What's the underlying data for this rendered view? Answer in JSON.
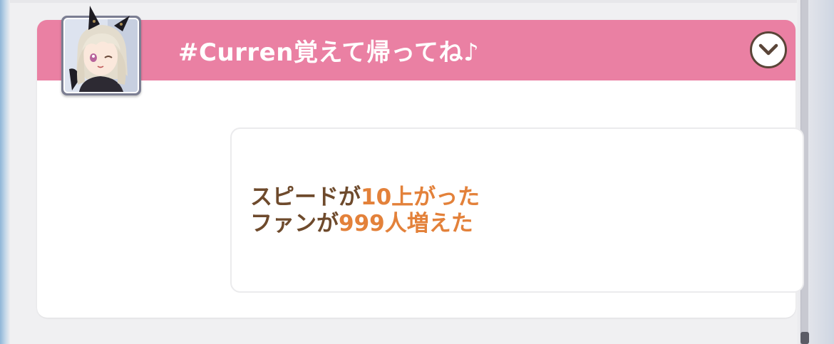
{
  "header": {
    "title": "#Curren覚えて帰ってね♪",
    "toggle_icon": "chevron-down-icon",
    "background_color": "#ea80a3"
  },
  "avatar": {
    "description_icon": "character-avatar"
  },
  "message": {
    "lines": [
      {
        "prefix": "スピードが",
        "highlight": "10上がった"
      },
      {
        "prefix": "ファンが",
        "highlight": "999人増えた"
      }
    ],
    "text_color": "#6e4a2c",
    "highlight_color": "#e3813a"
  }
}
